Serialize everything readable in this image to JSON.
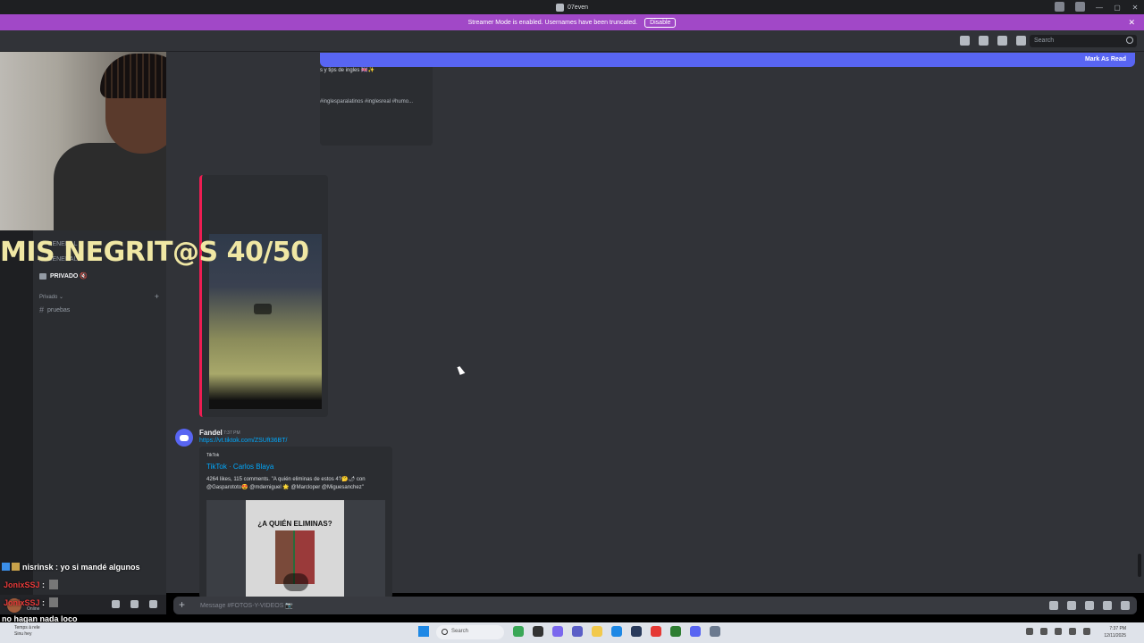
{
  "window": {
    "title": "07even",
    "controls": [
      "—",
      "▢",
      "✕"
    ]
  },
  "streamer_banner": {
    "text": "Streamer Mode is enabled. Usernames have been truncated.",
    "disable_label": "Disable"
  },
  "header": {
    "search_placeholder": "Search"
  },
  "new_messages_bar": {
    "mark_read_label": "Mark As Read"
  },
  "top_embed": {
    "line1": "s y tips de ingles 🇬🇧✨",
    "line2": "#inglesparalatinos #inglesreal #humo..."
  },
  "message": {
    "author": "Fandel",
    "time": "7:37 PM",
    "link": "https://vt.tiktok.com/ZSUft36BT/",
    "embed": {
      "provider": "TikTok",
      "title": "TikTok · Carlos Blaya",
      "description": "4264 likes, 115 comments. \"A quién eliminas de estos 4?🤔🌶 con @Gasparototo😍 @mdemiguel 🌟 @Marcloper @Miguesanchez\"",
      "thumbnail_text": "¿A QUIÉN ELIMINAS?"
    }
  },
  "composer": {
    "placeholder": "Message #FOTOS-Y-VIDEOS 📷"
  },
  "sidebar": {
    "items": [
      {
        "label": "GENERAL",
        "type": "text"
      },
      {
        "label": "GENERAL 2",
        "type": "text"
      },
      {
        "label": "PRIVADO 🔇",
        "type": "voice"
      }
    ],
    "category": "Privado",
    "channel": "pruebas",
    "status": "Online"
  },
  "overlay": {
    "title": "MIS NEGRIT@S 40/50"
  },
  "stream_chat": [
    {
      "user": "nisrinsk",
      "message": "yo si mandé algunos"
    },
    {
      "user": "JonixSSJ",
      "message": ""
    },
    {
      "user": "JonixSSJ",
      "message": ""
    },
    {
      "user": "",
      "message": "no hagan nada loco"
    }
  ],
  "taskbar": {
    "weather_line1": "Temps à rele",
    "weather_line2": "Sinu hey",
    "search_label": "Search",
    "time": "7:37 PM",
    "date": "12/11/2025"
  },
  "colors": {
    "streamer_banner": "#a148c7",
    "new_messages_bar": "#5865f2",
    "link": "#00a8fc",
    "tiktok_accent": "#ee1d52",
    "overlay_text": "#f0e7a4"
  }
}
